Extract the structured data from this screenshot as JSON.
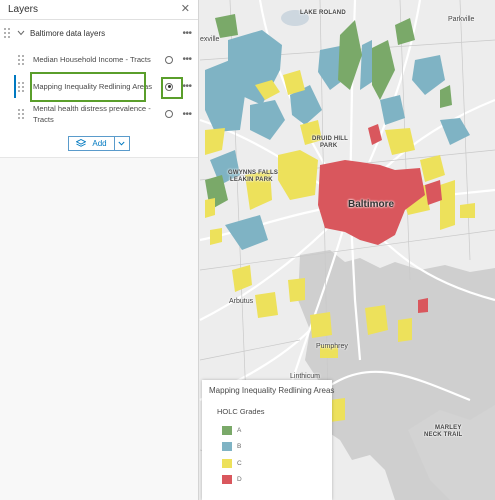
{
  "panel": {
    "title": "Layers",
    "close_icon": "close-icon",
    "group": {
      "label": "Baltimore data layers"
    },
    "layers": [
      {
        "label": "Median Household Income - Tracts",
        "selected": false
      },
      {
        "label": "Mapping Inequality Redlining Areas",
        "selected": true
      },
      {
        "label": "Mental health distress prevalence - Tracts",
        "selected": false
      }
    ],
    "add_button": {
      "label": "Add",
      "icon": "layers-add-icon",
      "caret_icon": "chevron-down-icon"
    },
    "more_icon": "more-horizontal-icon",
    "highlight_color": "#5a9e2b",
    "selected_accent": "#0079c1"
  },
  "map": {
    "labels": {
      "lake_roland": "LAKE ROLAND",
      "parkville": "Parkville",
      "druid_hill": "DRUID HILL",
      "druid_hill2": "PARK",
      "gwynns": "GWYNNS FALLS",
      "gwynns2": "LEAKIN PARK",
      "baltimore": "Baltimore",
      "arbutus": "Arbutus",
      "pumphrey": "Pumphrey",
      "linthicum": "Linthicum",
      "marley": "MARLEY",
      "marley2": "NECK TRAIL",
      "essex_partial": "exville"
    }
  },
  "legend": {
    "title": "Mapping Inequality Redlining Areas",
    "subtitle": "HOLC Grades",
    "items": [
      {
        "label": "A",
        "color": "#7aa969"
      },
      {
        "label": "B",
        "color": "#7fb3c4"
      },
      {
        "label": "C",
        "color": "#ede15b"
      },
      {
        "label": "D",
        "color": "#d9575d"
      }
    ]
  }
}
